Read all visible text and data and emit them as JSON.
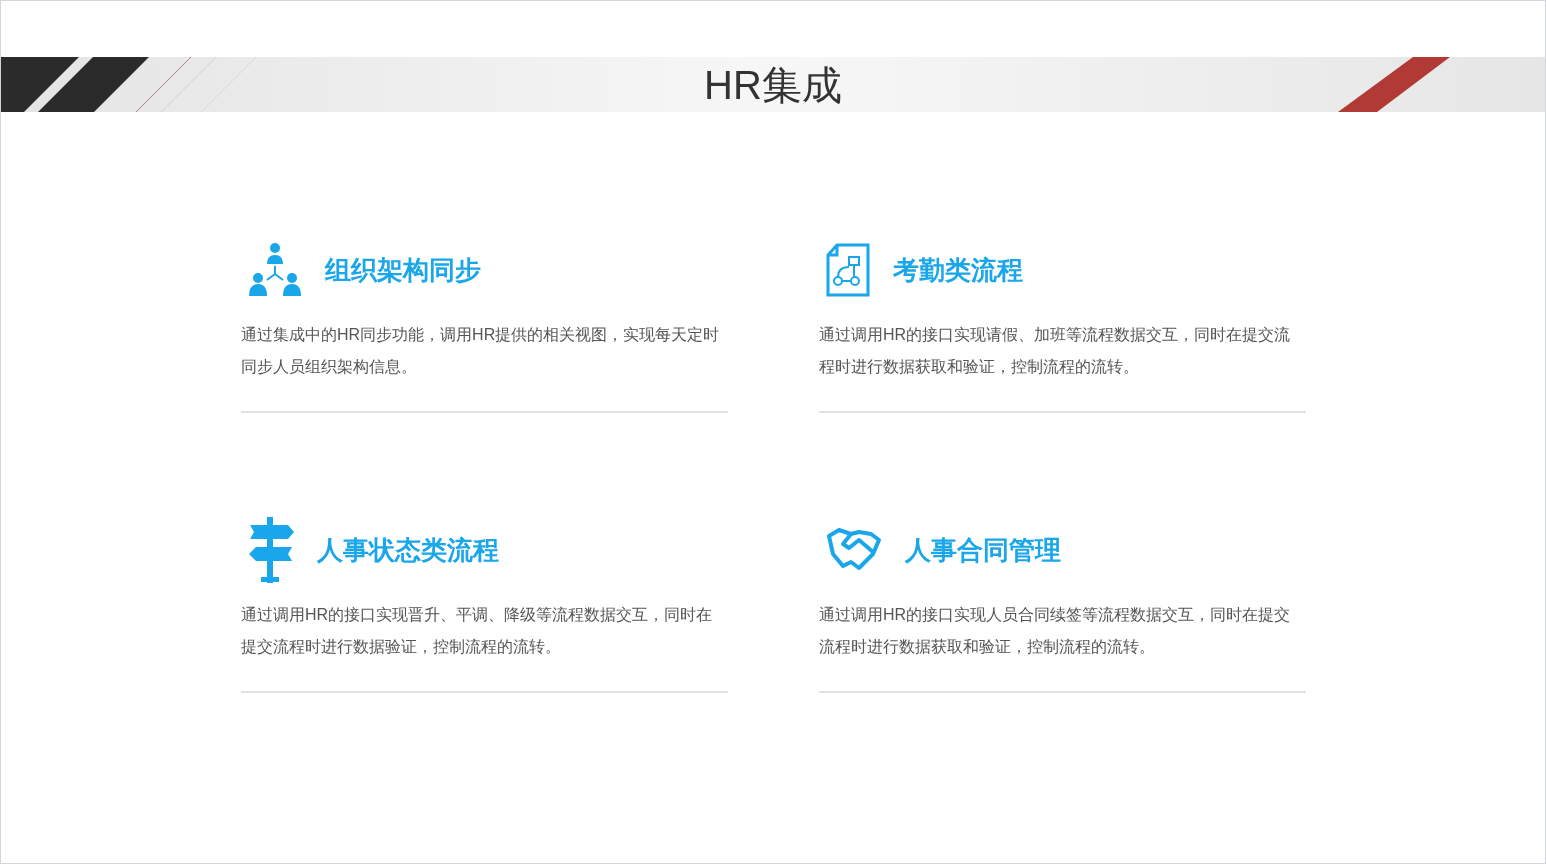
{
  "banner": {
    "title": "HR集成"
  },
  "features": [
    {
      "kind": "org",
      "title": "组织架构同步",
      "description": "通过集成中的HR同步功能，调用HR提供的相关视图，实现每天定时同步人员组织架构信息。"
    },
    {
      "kind": "flow",
      "title": "考勤类流程",
      "description": "通过调用HR的接口实现请假、加班等流程数据交互，同时在提交流程时进行数据获取和验证，控制流程的流转。"
    },
    {
      "kind": "signpost",
      "title": "人事状态类流程",
      "description": "通过调用HR的接口实现晋升、平调、降级等流程数据交互，同时在提交流程时进行数据验证，控制流程的流转。"
    },
    {
      "kind": "handshake",
      "title": "人事合同管理",
      "description": "通过调用HR的接口实现人员合同续签等流程数据交互，同时在提交流程时进行数据获取和验证，控制流程的流转。"
    }
  ]
}
